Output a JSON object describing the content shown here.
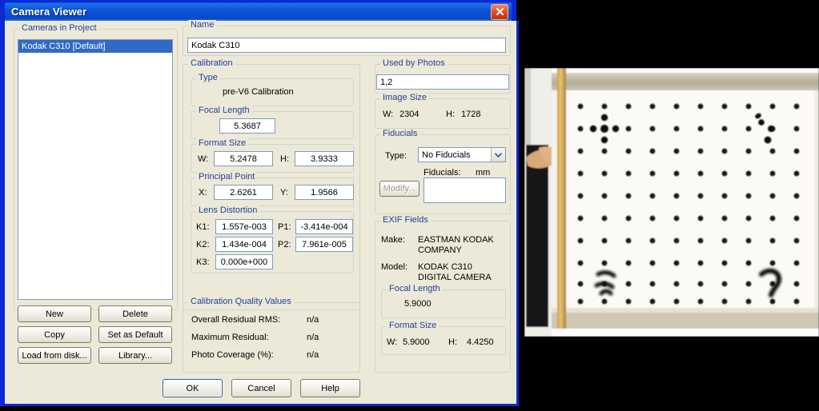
{
  "window": {
    "title": "Camera Viewer",
    "close_label": "Close"
  },
  "left_panel": {
    "group_label": "Cameras in Project",
    "items": [
      {
        "label": "Kodak C310 [Default]",
        "selected": true
      }
    ],
    "buttons": [
      {
        "label": "New"
      },
      {
        "label": "Delete"
      },
      {
        "label": "Copy"
      },
      {
        "label": "Set as Default"
      },
      {
        "label": "Load from disk..."
      },
      {
        "label": "Library..."
      }
    ]
  },
  "name_group": {
    "legend": "Name",
    "value": "Kodak C310"
  },
  "calibration": {
    "legend": "Calibration",
    "type": {
      "legend": "Type",
      "value": "pre-V6 Calibration"
    },
    "focal_length": {
      "legend": "Focal Length",
      "value": "5.3687"
    },
    "format_size": {
      "legend": "Format Size",
      "w_label": "W:",
      "w_value": "5.2478",
      "h_label": "H:",
      "h_value": "3.9333"
    },
    "principal_point": {
      "legend": "Principal Point",
      "x_label": "X:",
      "x_value": "2.6261",
      "y_label": "Y:",
      "y_value": "1.9566"
    },
    "lens_distortion": {
      "legend": "Lens Distortion",
      "k1_label": "K1:",
      "k1_value": "1.557e-003",
      "p1_label": "P1:",
      "p1_value": "-3.414e-004",
      "k2_label": "K2:",
      "k2_value": "1.434e-004",
      "p2_label": "P2:",
      "p2_value": "7.961e-005",
      "k3_label": "K3:",
      "k3_value": "0.000e+000"
    },
    "quality": {
      "legend": "Calibration Quality Values",
      "rows": [
        {
          "label": "Overall Residual RMS:",
          "value": "n/a"
        },
        {
          "label": "Maximum Residual:",
          "value": "n/a"
        },
        {
          "label": "Photo Coverage (%):",
          "value": "n/a"
        }
      ]
    }
  },
  "used_by_photos": {
    "legend": "Used by Photos",
    "value": "1,2"
  },
  "image_size": {
    "legend": "Image Size",
    "w_label": "W:",
    "w_value": "2304",
    "h_label": "H:",
    "h_value": "1728"
  },
  "fiducials": {
    "legend": "Fiducials",
    "type_label": "Type:",
    "type_value": "No Fiducials",
    "fiducials_label": "Fiducials:",
    "units_label": "mm",
    "modify_label": "Modify...",
    "list_value": ""
  },
  "exif": {
    "legend": "EXIF Fields",
    "make_label": "Make:",
    "make_value_line1": "EASTMAN KODAK",
    "make_value_line2": "COMPANY",
    "model_label": "Model:",
    "model_value_line1": "KODAK C310",
    "model_value_line2": "DIGITAL CAMERA",
    "focal_length": {
      "legend": "Focal Length",
      "value": "5.9000"
    },
    "format_size": {
      "legend": "Format Size",
      "w_label": "W:",
      "w_value": "5.9000",
      "h_label": "H:",
      "h_value": "4.4250"
    }
  },
  "dialog_buttons": {
    "ok": "OK",
    "cancel": "Cancel",
    "help": "Help"
  },
  "photo": {
    "description": "Calibration target photograph: white board with black dot grid, wooden pole and hand at left",
    "grid_cols": 10,
    "grid_rows": 10,
    "colors": {
      "board": "#f7f5f1",
      "dot": "#1a1a1a",
      "frame": "#b9b3a0",
      "pole": "#d3a94e",
      "backdrop": "#000000"
    }
  },
  "theme": {
    "title_bar_blue": "#0a4fd8",
    "dialog_face": "#ece9d8",
    "group_label_blue": "#22409a",
    "selection_blue": "#316ac5",
    "border_blue": "#0a2ad4"
  }
}
